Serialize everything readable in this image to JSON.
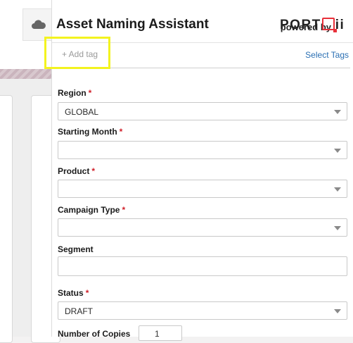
{
  "header": {
    "title": "Asset Naming Assistant",
    "powered_by": "powered by",
    "logo_text_left": "PORT",
    "logo_text_right": "ii"
  },
  "tags": {
    "add_placeholder": "+ Add tag",
    "select_link": "Select Tags"
  },
  "form": {
    "region": {
      "label": "Region",
      "value": "GLOBAL",
      "required": true
    },
    "starting_month": {
      "label": "Starting Month",
      "value": "",
      "required": true
    },
    "product": {
      "label": "Product",
      "value": "",
      "required": true
    },
    "campaign_type": {
      "label": "Campaign Type",
      "value": "",
      "required": true
    },
    "segment": {
      "label": "Segment",
      "value": ""
    },
    "status": {
      "label": "Status",
      "value": "DRAFT",
      "required": true
    },
    "copies": {
      "label": "Number of Copies",
      "value": "1"
    }
  },
  "required_marker": "*",
  "colors": {
    "accent_link": "#2a6fb3",
    "required": "#d0202a",
    "highlight": "#f3f31f",
    "logo_red": "#e8303a"
  },
  "icons": {
    "sidebar_tab": "cloud-icon",
    "dropdown": "chevron-down-icon"
  }
}
